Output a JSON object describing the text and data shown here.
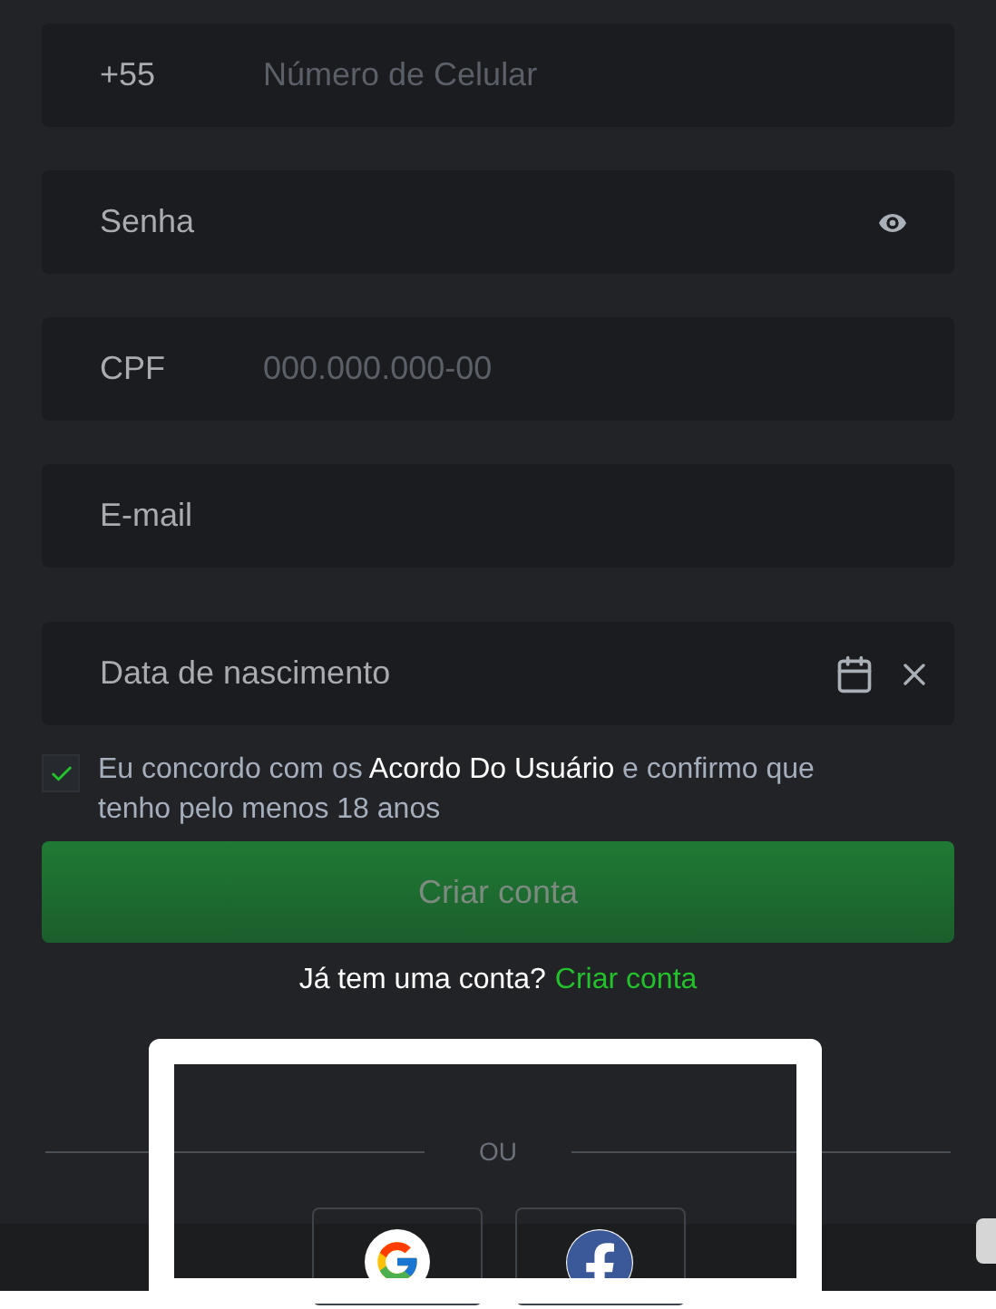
{
  "fields": [
    {
      "kind": "phone",
      "prefix": "+55",
      "placeholder": "Número de Celular"
    },
    {
      "kind": "password",
      "placeholder": "Senha"
    },
    {
      "kind": "cpf",
      "prefix": "CPF",
      "placeholder": "000.000.000-00"
    },
    {
      "kind": "text",
      "placeholder": "E-mail"
    },
    {
      "kind": "date",
      "placeholder": "Data de nascimento"
    }
  ],
  "agreement": {
    "checked": true,
    "before": "Eu concordo com os",
    "link": "Acordo Do Usuário",
    "after": "e confirmo que tenho pelo menos 18 anos"
  },
  "submit": {
    "label": "Criar conta",
    "disabled": true
  },
  "login_prompt": {
    "text": "Já tem uma conta?",
    "link": "Criar conta"
  },
  "divider": "OU",
  "social": [
    {
      "kind": "google"
    },
    {
      "kind": "facebook"
    }
  ]
}
